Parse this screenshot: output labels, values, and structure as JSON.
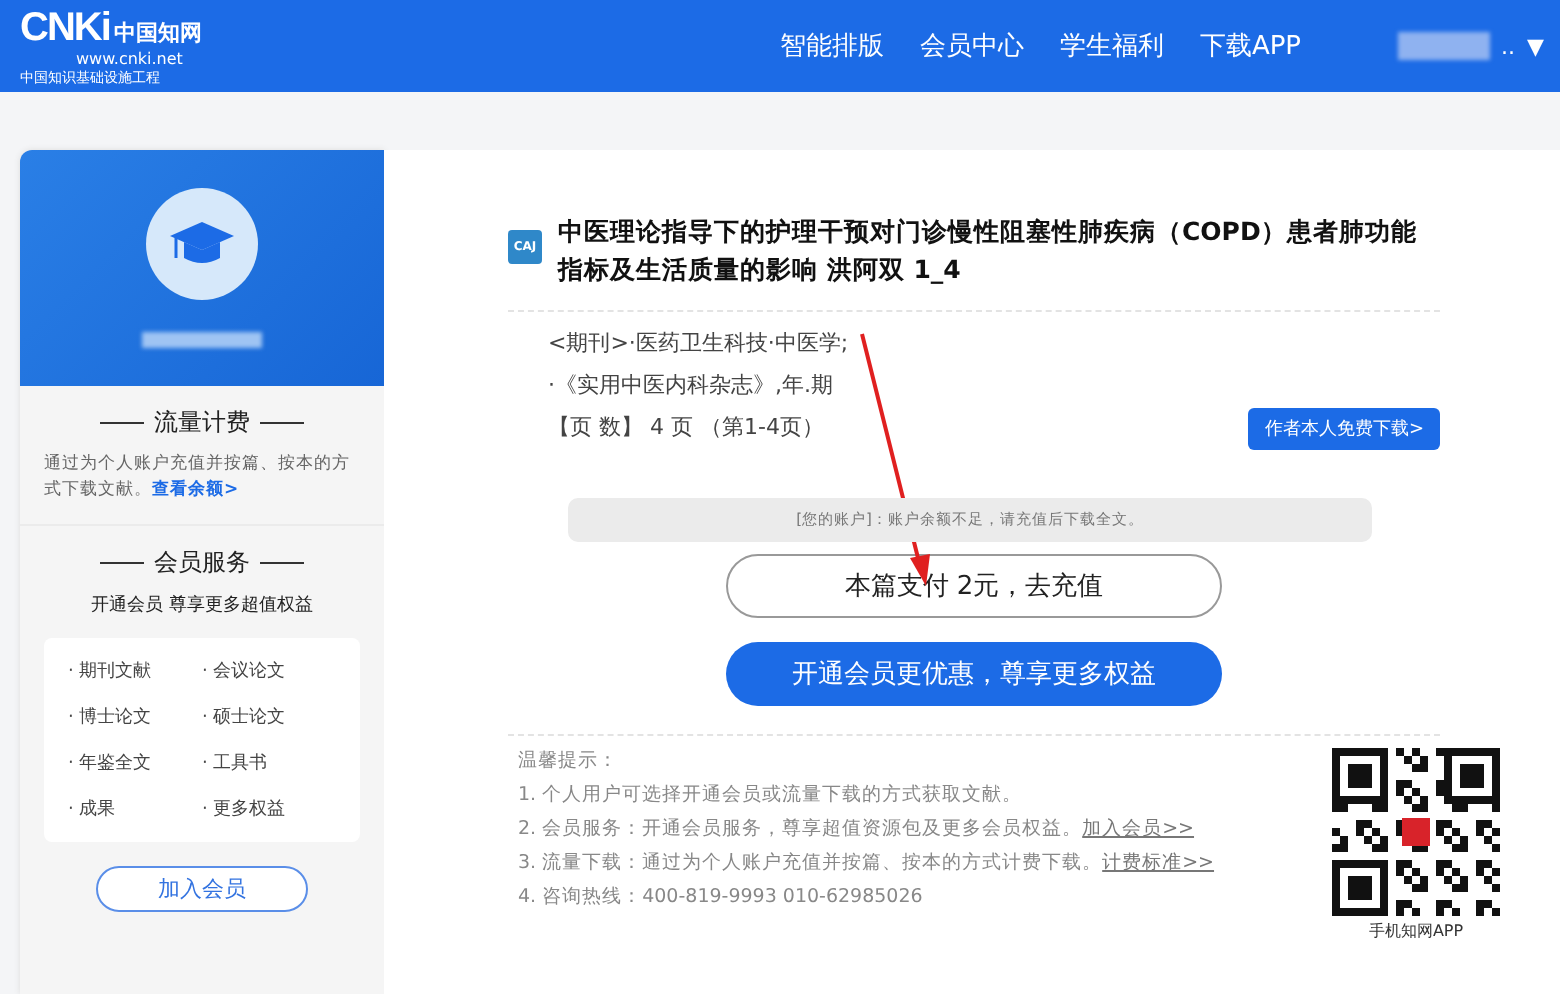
{
  "header": {
    "logo": {
      "mark": "CNKi",
      "name": "中国知网",
      "url": "www.cnki.net",
      "slogan": "中国知识基础设施工程"
    },
    "nav": [
      {
        "label": "智能排版"
      },
      {
        "label": "会员中心"
      },
      {
        "label": "学生福利"
      },
      {
        "label": "下载APP"
      }
    ],
    "user_menu": {
      "ellipsis": "..",
      "caret": "▼"
    }
  },
  "sidebar": {
    "traffic": {
      "title": "流量计费",
      "description": "通过为个人账户充值并按篇、按本的方式下载文献。",
      "link": "查看余额>"
    },
    "membership": {
      "title": "会员服务",
      "subtitle": "开通会员 尊享更多超值权益",
      "benefits": [
        {
          "label": "· 期刊文献"
        },
        {
          "label": "· 会议论文"
        },
        {
          "label": "· 博士论文"
        },
        {
          "label": "· 硕士论文"
        },
        {
          "label": "· 年鉴全文"
        },
        {
          "label": "· 工具书"
        },
        {
          "label": "· 成果"
        },
        {
          "label": "· 更多权益"
        }
      ],
      "join_button": "加入会员"
    }
  },
  "document": {
    "file_type": "CAJ",
    "title": "中医理论指导下的护理干预对门诊慢性阻塞性肺疾病（COPD）患者肺功能指标及生活质量的影响 洪阿双 1_4",
    "meta": [
      "<期刊>·医药卫生科技·中医学;",
      "·《实用中医内科杂志》,年.期",
      "【页 数】 4 页 （第1-4页）"
    ],
    "author_button": "作者本人免费下载>",
    "notice": "[您的账户]：账户余额不足，请充值后下载全文。",
    "pay_button": "本篇支付 2元，去充值",
    "member_button": "开通会员更优惠，尊享更多权益",
    "tips": {
      "heading": "温馨提示：",
      "items": [
        {
          "text": "1. 个人用户可选择开通会员或流量下载的方式获取文献。"
        },
        {
          "text": "2. 会员服务：开通会员服务，尊享超值资源包及更多会员权益。",
          "link": "加入会员>>"
        },
        {
          "text": "3. 流量下载：通过为个人账户充值并按篇、按本的方式计费下载。",
          "link": "计费标准>>"
        },
        {
          "text": "4. 咨询热线：400-819-9993 010-62985026"
        }
      ]
    },
    "qr_caption": "手机知网APP"
  }
}
